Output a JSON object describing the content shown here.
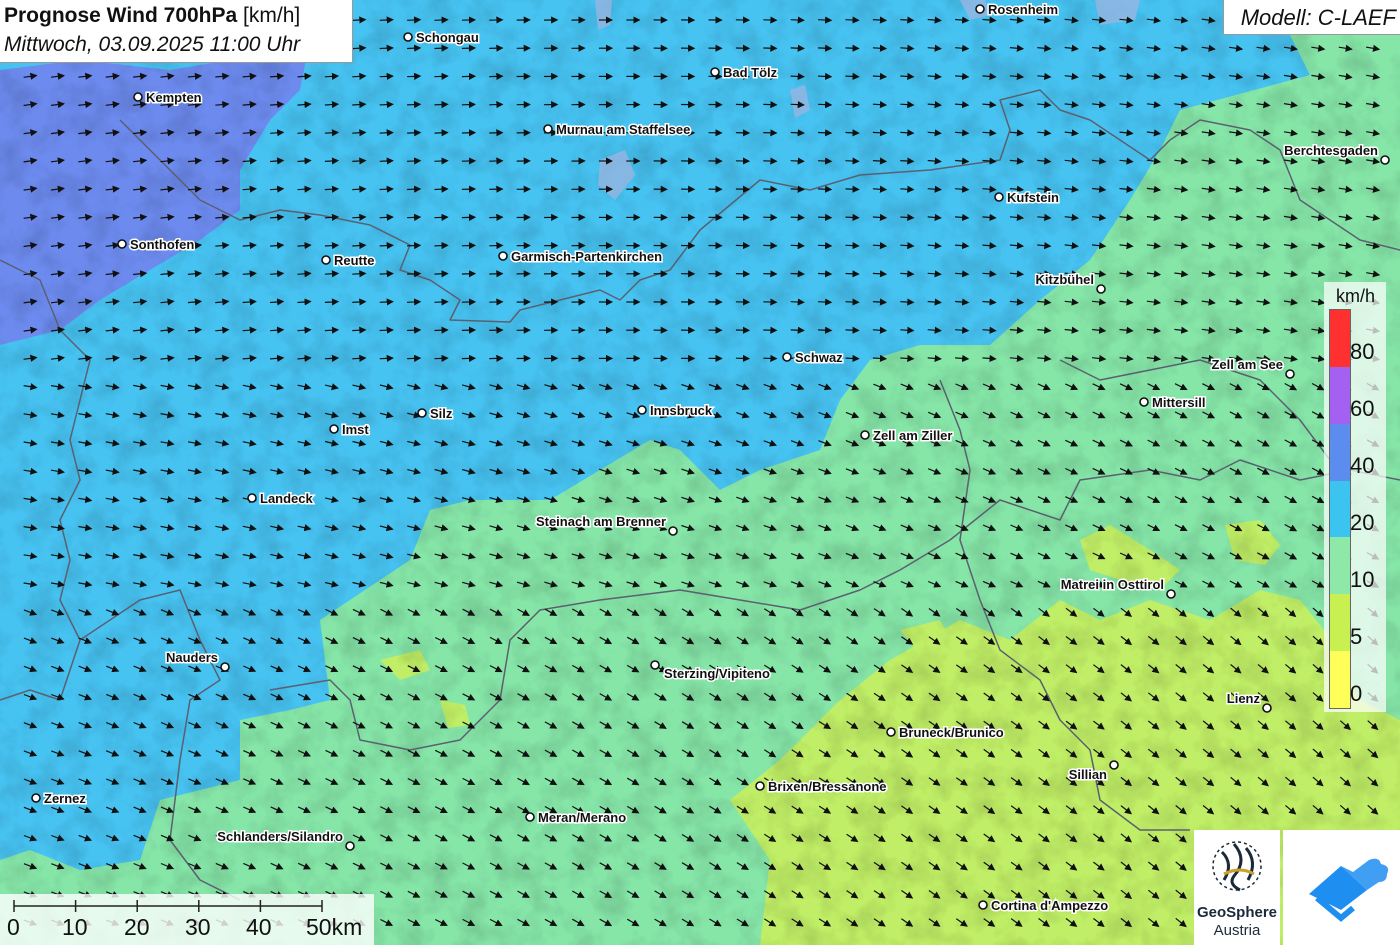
{
  "title": {
    "main": "Prognose Wind 700hPa",
    "unit": "[km/h]",
    "datetime": "Mittwoch, 03.09.2025 11:00 Uhr"
  },
  "model": "Modell: C-LAEF",
  "legend": {
    "unit": "km/h",
    "labels": [
      "80",
      "60",
      "40",
      "20",
      "10",
      "5",
      "0"
    ],
    "colors": [
      "#ff3030",
      "#a460f0",
      "#5d8cef",
      "#3bc4f0",
      "#8ee8a8",
      "#c8f050",
      "#ffff5a"
    ]
  },
  "scalebar": {
    "labels": [
      "0",
      "10",
      "20",
      "30",
      "40",
      "50km"
    ]
  },
  "cities": [
    {
      "name": "Rosenheim"
    },
    {
      "name": "Schongau"
    },
    {
      "name": "Bad Tölz"
    },
    {
      "name": "Kempten"
    },
    {
      "name": "Murnau am Staffelsee"
    },
    {
      "name": "Berchtesgaden"
    },
    {
      "name": "Kufstein"
    },
    {
      "name": "Sonthofen"
    },
    {
      "name": "Reutte"
    },
    {
      "name": "Garmisch-Partenkirchen"
    },
    {
      "name": "Kitzbühel"
    },
    {
      "name": "Schwaz"
    },
    {
      "name": "Zell am See"
    },
    {
      "name": "Silz"
    },
    {
      "name": "Innsbruck"
    },
    {
      "name": "Mittersill"
    },
    {
      "name": "Imst"
    },
    {
      "name": "Zell am Ziller"
    },
    {
      "name": "Landeck"
    },
    {
      "name": "Steinach am Brenner"
    },
    {
      "name": "Matrei in Osttirol"
    },
    {
      "name": "Nauders"
    },
    {
      "name": "Sterzing/Vipiteno"
    },
    {
      "name": "Lienz"
    },
    {
      "name": "Bruneck/Brunico"
    },
    {
      "name": "Sillian"
    },
    {
      "name": "Brixen/Bressanone"
    },
    {
      "name": "Zernez"
    },
    {
      "name": "Meran/Merano"
    },
    {
      "name": "Schlanders/Silandro"
    },
    {
      "name": "Cortina d'Ampezzo"
    }
  ],
  "logos": {
    "geosphere_name": "GeoSphere",
    "geosphere_sub": "Austria"
  }
}
